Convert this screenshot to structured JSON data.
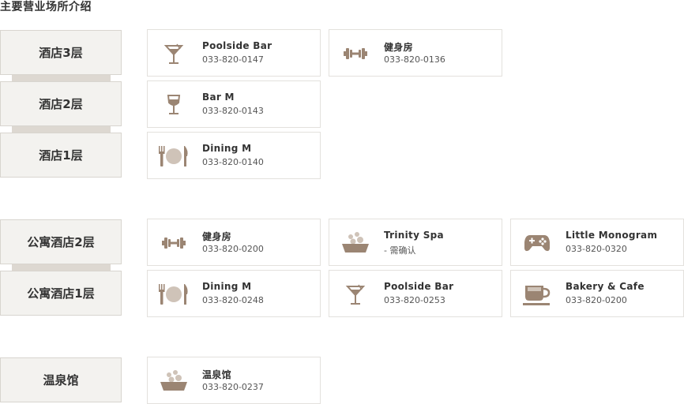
{
  "page_title": "主要营业场所介绍",
  "colors": {
    "icon": "#9b8573",
    "icon_light": "#cfc3b8",
    "floor_bg": "#f3f2ef",
    "connector": "#ddd8d1"
  },
  "floors": [
    {
      "label": "酒店3层",
      "cards": [
        {
          "name": "Poolside Bar",
          "phone": "033-820-0147",
          "icon": "cocktail-icon"
        },
        {
          "name": "健身房",
          "phone": "033-820-0136",
          "icon": "dumbbell-icon"
        }
      ]
    },
    {
      "label": "酒店2层",
      "cards": [
        {
          "name": "Bar M",
          "phone": "033-820-0143",
          "icon": "wine-glass-icon"
        }
      ]
    },
    {
      "label": "酒店1层",
      "cards": [
        {
          "name": "Dining M",
          "phone": "033-820-0140",
          "icon": "dining-icon"
        }
      ]
    },
    {
      "label": "公寓酒店2层",
      "cards": [
        {
          "name": "健身房",
          "phone": "033-820-0200",
          "icon": "dumbbell-icon"
        },
        {
          "name": "Trinity Spa",
          "phone": "- 需确认",
          "icon": "spa-bowl-icon"
        },
        {
          "name": "Little Monogram",
          "phone": "033-820-0320",
          "icon": "gamepad-icon"
        }
      ]
    },
    {
      "label": "公寓酒店1层",
      "cards": [
        {
          "name": "Dining M",
          "phone": "033-820-0248",
          "icon": "dining-icon"
        },
        {
          "name": "Poolside Bar",
          "phone": "033-820-0253",
          "icon": "cocktail-icon"
        },
        {
          "name": "Bakery & Cafe",
          "phone": "033-820-0200",
          "icon": "coffee-cup-icon"
        }
      ]
    },
    {
      "label": "温泉馆",
      "cards": [
        {
          "name": "温泉馆",
          "phone": "033-820-0237",
          "icon": "spa-bowl-icon"
        }
      ]
    }
  ]
}
